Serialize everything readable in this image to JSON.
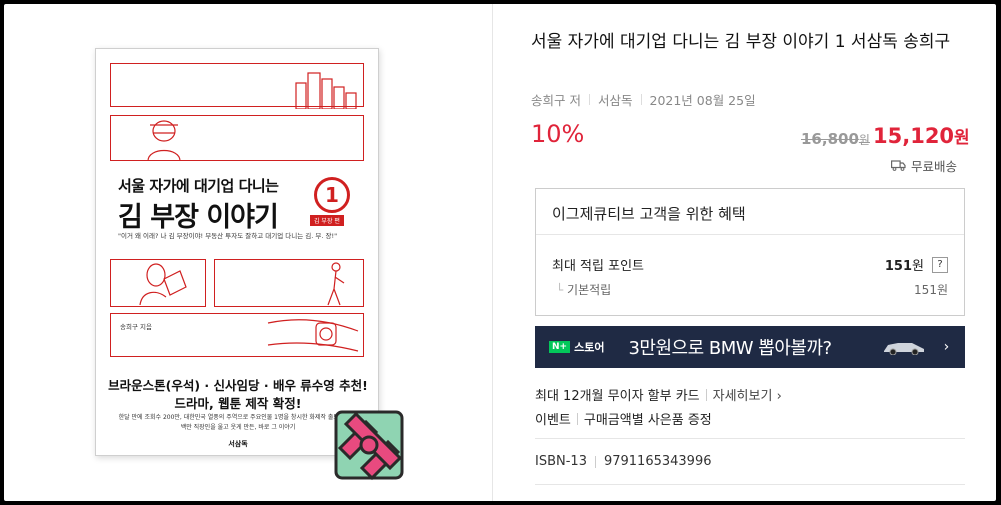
{
  "book": {
    "title": "서울 자가에 대기업 다니는 김 부장 이야기 1 서삼독 송희구",
    "author": "송희구 저",
    "publisher": "서삼독",
    "date": "2021년 08월 25일"
  },
  "cover": {
    "title_line1": "서울 자가에 대기업 다니는",
    "title_line2": "김 부장 이야기",
    "volume": "1",
    "volume_tag": "김 부장 편",
    "quote": "\"이거 왜 이래? 나 김 부장이야! 부동산 투자도 잘하고 대기업 다니는 김. 부. 장!\"",
    "author": "송희구 지음",
    "recommend_line1": "브라운스톤(우석) · 신사임당 · 배우 류수영 추천!",
    "recommend_line2": "드라마, 웹툰 제작 확정!",
    "small_text": "한달 만에 조회수 200만, 대한민국 열풍의 주역으로 주요인물 1명을 창시한 화제작 출퇴근길 수백만 직장인을 울고 웃게 만든, 바로 그 이야기",
    "publisher": "서삼독"
  },
  "price": {
    "discount": "10%",
    "original": "16,800",
    "original_unit": "원",
    "sale": "15,120",
    "sale_unit": "원",
    "shipping": "무료배송"
  },
  "benefit": {
    "heading": "이그제큐티브 고객을 위한 혜택",
    "points_label": "최대 적립 포인트",
    "points_value": "151",
    "points_unit": "원",
    "help": "?",
    "basic_label": "기본적립",
    "basic_value": "151원"
  },
  "banner": {
    "store_badge": "N+",
    "store_label": "스토어",
    "text": "3만원으로 BMW 뽑아볼까?",
    "arrow": "›"
  },
  "info": {
    "installment": "최대 12개월 무이자 할부 카드",
    "details_link": "자세히보기 ›",
    "event_label": "이벤트",
    "event_text": "구매금액별 사은품 증정",
    "isbn_label": "ISBN-13",
    "isbn_value": "9791165343996"
  },
  "colors": {
    "accent_red": "#e0243a",
    "banner_bg": "#1f2a44",
    "naver_green": "#03c75a",
    "cover_red": "#d02020"
  }
}
